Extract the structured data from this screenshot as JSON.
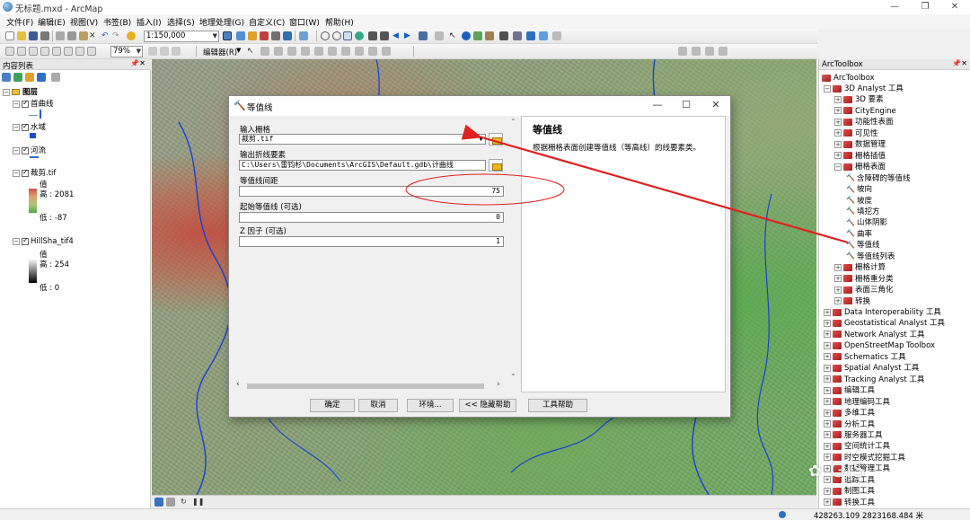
{
  "window": {
    "title": "无标题.mxd - ArcMap"
  },
  "menu": [
    "文件(F)",
    "编辑(E)",
    "视图(V)",
    "书签(B)",
    "插入(I)",
    "选择(S)",
    "地理处理(G)",
    "自定义(C)",
    "窗口(W)",
    "帮助(H)"
  ],
  "toolbar": {
    "scale": "1:150,000",
    "zoom": "79%",
    "editor_label": "编辑器(R)"
  },
  "toc": {
    "title": "内容列表",
    "layers_group": "图层",
    "layers": [
      {
        "name": "首曲线"
      },
      {
        "name": "水域"
      },
      {
        "name": "河流"
      },
      {
        "name": "裁剪.tif",
        "legend_title": "值",
        "high": "高 : 2081",
        "low": "低 : -87"
      },
      {
        "name": "HillSha_tif4",
        "legend_title": "值",
        "high": "高 : 254",
        "low": "低 : 0"
      }
    ]
  },
  "toolbox": {
    "title": "ArcToolbox",
    "root": "ArcToolbox",
    "items": [
      {
        "label": "3D Analyst 工具",
        "level": 1,
        "kind": "box",
        "expanded": true
      },
      {
        "label": "3D 要素",
        "level": 2,
        "kind": "box"
      },
      {
        "label": "CityEngine",
        "level": 2,
        "kind": "box"
      },
      {
        "label": "功能性表面",
        "level": 2,
        "kind": "box"
      },
      {
        "label": "可见性",
        "level": 2,
        "kind": "box"
      },
      {
        "label": "数据管理",
        "level": 2,
        "kind": "box"
      },
      {
        "label": "栅格插值",
        "level": 2,
        "kind": "box"
      },
      {
        "label": "栅格表面",
        "level": 2,
        "kind": "box",
        "expanded": true
      },
      {
        "label": "含障碍的等值线",
        "level": 3,
        "kind": "tool"
      },
      {
        "label": "坡向",
        "level": 3,
        "kind": "tool"
      },
      {
        "label": "坡度",
        "level": 3,
        "kind": "tool"
      },
      {
        "label": "填挖方",
        "level": 3,
        "kind": "tool"
      },
      {
        "label": "山体阴影",
        "level": 3,
        "kind": "tool"
      },
      {
        "label": "曲率",
        "level": 3,
        "kind": "tool"
      },
      {
        "label": "等值线",
        "level": 3,
        "kind": "tool"
      },
      {
        "label": "等值线列表",
        "level": 3,
        "kind": "tool"
      },
      {
        "label": "栅格计算",
        "level": 2,
        "kind": "box"
      },
      {
        "label": "栅格重分类",
        "level": 2,
        "kind": "box"
      },
      {
        "label": "表面三角化",
        "level": 2,
        "kind": "box"
      },
      {
        "label": "转换",
        "level": 2,
        "kind": "box"
      },
      {
        "label": "Data Interoperability 工具",
        "level": 1,
        "kind": "box"
      },
      {
        "label": "Geostatistical Analyst 工具",
        "level": 1,
        "kind": "box"
      },
      {
        "label": "Network Analyst 工具",
        "level": 1,
        "kind": "box"
      },
      {
        "label": "OpenStreetMap Toolbox",
        "level": 1,
        "kind": "box"
      },
      {
        "label": "Schematics 工具",
        "level": 1,
        "kind": "box"
      },
      {
        "label": "Spatial Analyst 工具",
        "level": 1,
        "kind": "box"
      },
      {
        "label": "Tracking Analyst 工具",
        "level": 1,
        "kind": "box"
      },
      {
        "label": "编辑工具",
        "level": 1,
        "kind": "box"
      },
      {
        "label": "地理编码工具",
        "level": 1,
        "kind": "box"
      },
      {
        "label": "多维工具",
        "level": 1,
        "kind": "box"
      },
      {
        "label": "分析工具",
        "level": 1,
        "kind": "box"
      },
      {
        "label": "服务器工具",
        "level": 1,
        "kind": "box"
      },
      {
        "label": "空间统计工具",
        "level": 1,
        "kind": "box"
      },
      {
        "label": "时空模式挖掘工具",
        "level": 1,
        "kind": "box"
      },
      {
        "label": "数据管理工具",
        "level": 1,
        "kind": "box"
      },
      {
        "label": "追踪工具",
        "level": 1,
        "kind": "box"
      },
      {
        "label": "制图工具",
        "level": 1,
        "kind": "box"
      },
      {
        "label": "转换工具",
        "level": 1,
        "kind": "box"
      }
    ]
  },
  "dialog": {
    "title": "等值线",
    "fields": [
      {
        "label": "输入栅格",
        "value": "裁剪.tif"
      },
      {
        "label": "输出折线要素",
        "value": "C:\\Users\\雷钧杉\\Documents\\ArcGIS\\Default.gdb\\计曲线"
      },
      {
        "label": "等值线间距",
        "value": "75"
      },
      {
        "label": "起始等值线 (可选)",
        "value": "0"
      },
      {
        "label": "Z 因子 (可选)",
        "value": "1"
      }
    ],
    "help_title": "等值线",
    "help_text": "根据栅格表面创建等值线（等高线）的线要素类。",
    "buttons": {
      "ok": "确定",
      "cancel": "取消",
      "env": "环境...",
      "hide_help": "<< 隐藏帮助",
      "tool_help": "工具帮助"
    }
  },
  "status": {
    "coords": "428263.109  2823168.484 米"
  },
  "watermark": "GIS",
  "colors": {
    "annotation": "#e02020",
    "accent": "#3399ff"
  }
}
